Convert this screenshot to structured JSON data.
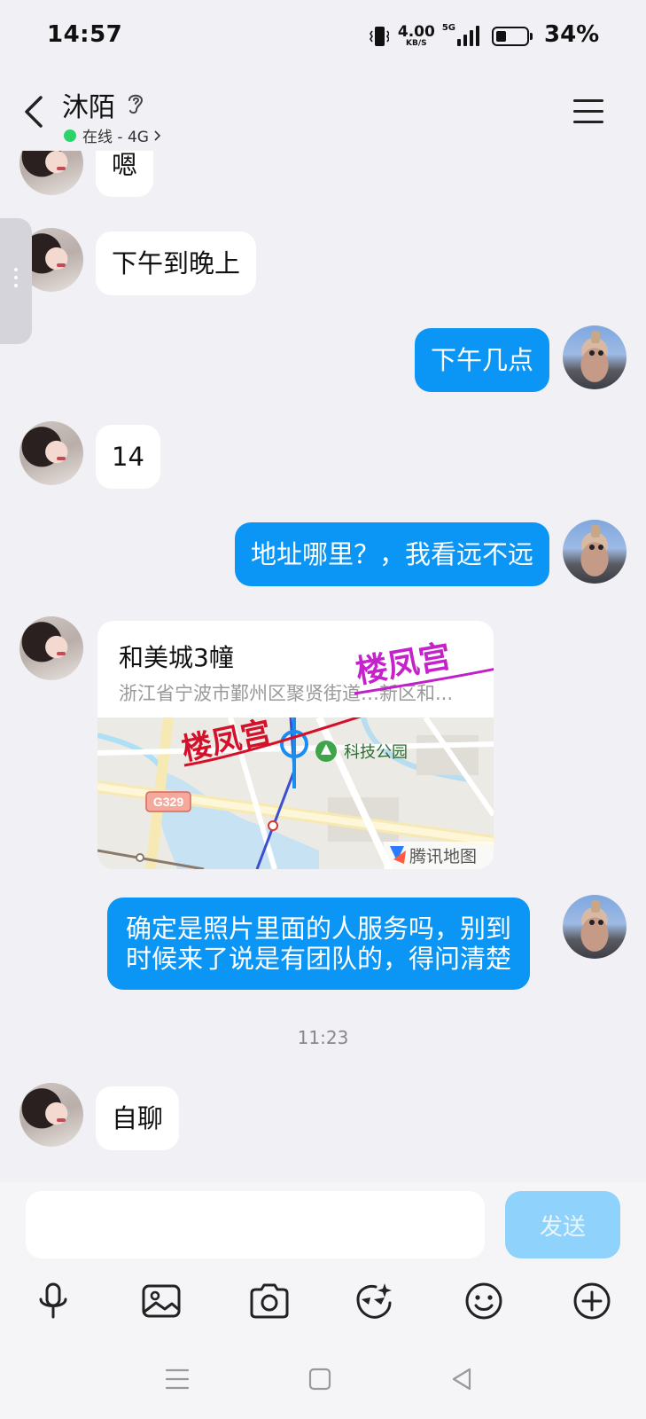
{
  "status_bar": {
    "time": "14:57",
    "speed_value": "4.00",
    "speed_unit": "KB/S",
    "network": "5G",
    "battery_percent": "34%",
    "battery_level": 0.34
  },
  "header": {
    "contact_name": "沐陌",
    "status_text": "在线 - 4G",
    "online_color": "#2bd46b"
  },
  "messages": [
    {
      "side": "in",
      "text": "嗯"
    },
    {
      "side": "in",
      "text": "下午到晚上"
    },
    {
      "side": "out",
      "text": "下午几点"
    },
    {
      "side": "in",
      "text": "14"
    },
    {
      "side": "out",
      "text": "地址哪里？，我看远不远"
    },
    {
      "side": "in",
      "type": "location",
      "title": "和美城3幢",
      "address": "浙江省宁波市鄞州区聚贤街道…新区和...",
      "map": {
        "stamp_text": "楼凤宫",
        "poi": "科技公园",
        "road": "G329",
        "provider": "腾讯地图"
      }
    },
    {
      "side": "out",
      "lines": [
        "确定是照片里面的人服务吗，别到",
        "时候来了说是有团队的，得问清楚"
      ]
    },
    {
      "side": "in",
      "text": "自聊"
    }
  ],
  "timestamp": "11:23",
  "composer": {
    "placeholder": "",
    "send_label": "发送"
  },
  "toolbar_icons": [
    "microphone-icon",
    "image-icon",
    "camera-icon",
    "sticker-face-icon",
    "emoji-icon",
    "plus-icon"
  ],
  "colors": {
    "outgoing_bubble": "#0b95f5",
    "incoming_bubble": "#ffffff",
    "background": "#f0f0f5",
    "send_button": "#8fd2fb"
  }
}
